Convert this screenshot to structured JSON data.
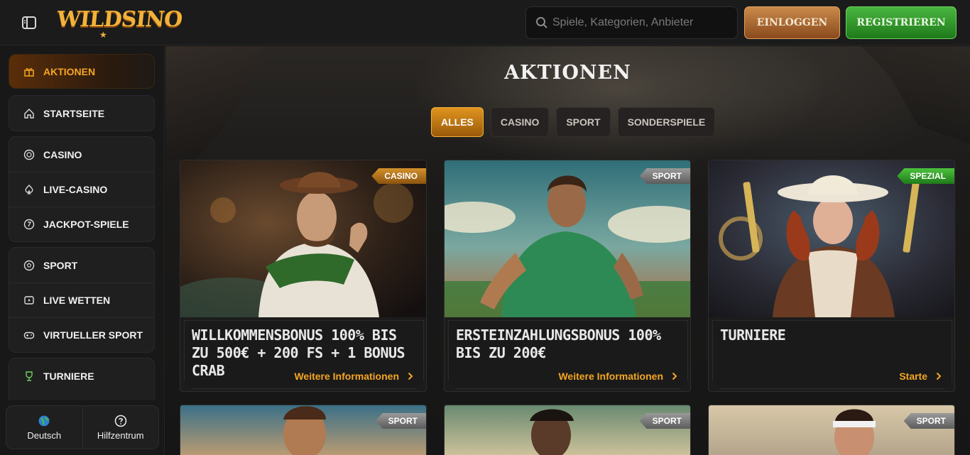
{
  "header": {
    "logo_text": "WILDSINO",
    "search_placeholder": "Spiele, Kategorien, Anbieter",
    "login_label": "EINLOGGEN",
    "register_label": "REGISTRIEREN"
  },
  "sidebar": {
    "active_item": "AKTIONEN",
    "groups": [
      [
        "STARTSEITE"
      ],
      [
        "CASINO",
        "LIVE-CASINO",
        "JACKPOT-SPIELE"
      ],
      [
        "SPORT",
        "LIVE WETTEN",
        "VIRTUELLER SPORT"
      ],
      [
        "TURNIERE"
      ]
    ],
    "language": "Deutsch",
    "help": "Hilfzentrum"
  },
  "main": {
    "title": "AKTIONEN",
    "filters": [
      "ALLES",
      "CASINO",
      "SPORT",
      "SONDERSPIELE"
    ],
    "active_filter": "ALLES",
    "cards": [
      {
        "tag": "CASINO",
        "title": "WILLKOMMENSBONUS 100% BIS ZU 500€ + 200 FS + 1 BONUS CRAB",
        "link": "Weitere Informationen"
      },
      {
        "tag": "SPORT",
        "title": "ERSTEINZAHLUNGSBONUS 100% BIS ZU 200€",
        "link": "Weitere Informationen"
      },
      {
        "tag": "SPEZIAL",
        "title": "TURNIERE",
        "link": "Starte"
      }
    ],
    "partial_cards": [
      {
        "tag": "SPORT"
      },
      {
        "tag": "SPORT"
      },
      {
        "tag": "SPORT"
      }
    ]
  },
  "colors": {
    "accent": "#f5a623",
    "login": "#b0703a",
    "register": "#2f9a28",
    "background": "#141414"
  }
}
